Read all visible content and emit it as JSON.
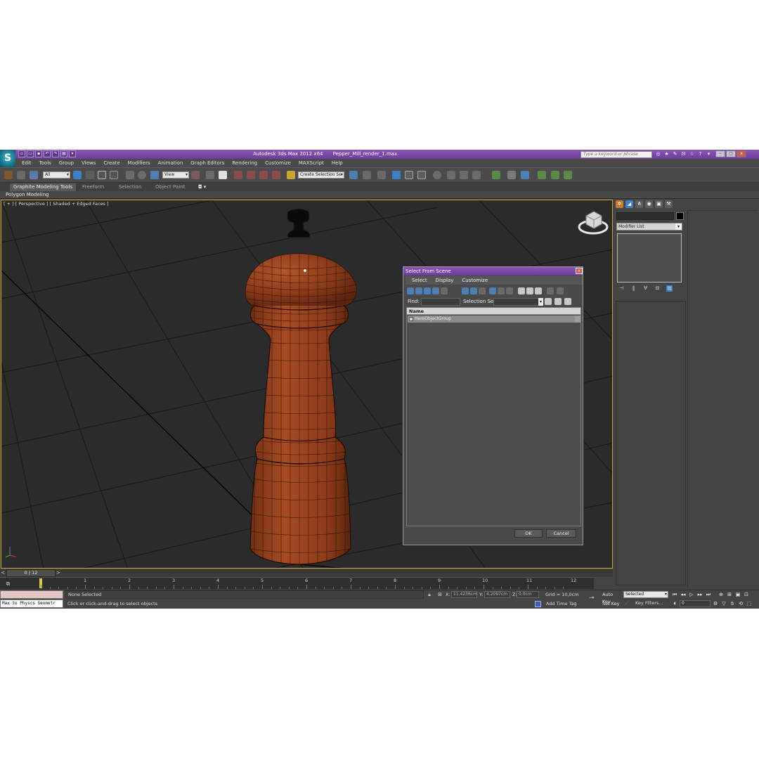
{
  "titlebar": {
    "app": "Autodesk 3ds Max 2012 x64",
    "file": "Pepper_Mill_render_1.max",
    "search_placeholder": "Type a keyword or phrase"
  },
  "menu": [
    "Edit",
    "Tools",
    "Group",
    "Views",
    "Create",
    "Modifiers",
    "Animation",
    "Graph Editors",
    "Rendering",
    "Customize",
    "MAXScript",
    "Help"
  ],
  "toolbar": {
    "filter_value": "All",
    "refcoord_value": "View",
    "selection_set_value": "Create Selection Se"
  },
  "ribbon": {
    "tabs": [
      "Graphite Modeling Tools",
      "Freeform",
      "Selection",
      "Object Paint"
    ],
    "subpanel": "Polygon Modeling"
  },
  "viewport": {
    "label": "[ + ] [ Perspective ] [ Shaded + Edged Faces ]"
  },
  "command_panel": {
    "modifier_list": "Modifier List"
  },
  "dialog": {
    "title": "Select From Scene",
    "close": "x",
    "menu": [
      "Select",
      "Display",
      "Customize"
    ],
    "find_label": "Find:",
    "selection_set_label": "Selection Set:",
    "column_name": "Name",
    "row_item": "HeroObjectGroup",
    "ok": "OK",
    "cancel": "Cancel"
  },
  "timeline": {
    "frame_counter": "0 / 12",
    "ticks": [
      "1",
      "2",
      "3",
      "4",
      "5",
      "6",
      "7",
      "8",
      "9",
      "10",
      "11",
      "12"
    ]
  },
  "status": {
    "script_line": "Max to Physcs Geometr",
    "selection_text": "None Selected",
    "prompt": "Click or click-and-drag to select objects",
    "x_label": "X:",
    "x_value": "11,4236cm",
    "y_label": "Y:",
    "y_value": "4,2097cm",
    "z_label": "Z:",
    "z_value": "0,0cm",
    "grid": "Grid = 10,0cm",
    "add_time_tag": "Add Time Tag",
    "auto_key": "Auto Key",
    "set_key": "Set Key",
    "key_mode": "Selected",
    "key_filters": "Key Filters...",
    "current_frame": "0"
  },
  "colors": {
    "title_bar": "#7a46a8",
    "viewport_bg": "#2b2b2b",
    "viewport_border": "#c9a431",
    "mill_wood": "#8a3a1a",
    "mill_knob": "#0a0a0a",
    "track_cursor": "#e3c74b"
  },
  "icons": [
    "app-logo-icon",
    "new-icon",
    "open-icon",
    "save-icon",
    "undo-icon",
    "redo-icon",
    "search-icon",
    "help-icon",
    "select-icon",
    "move-icon",
    "rotate-icon",
    "scale-icon",
    "snap-icon",
    "mirror-icon",
    "align-icon",
    "render-icon",
    "viewcube-icon",
    "key-icon",
    "play-icon"
  ]
}
